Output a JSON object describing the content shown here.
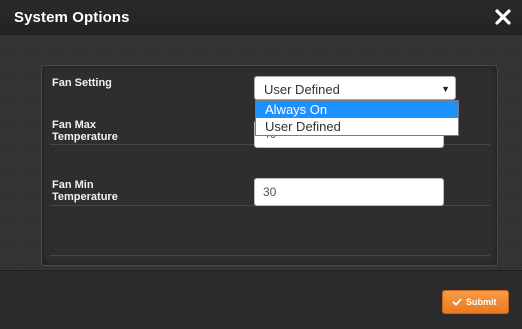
{
  "dialog": {
    "title": "System Options"
  },
  "fan_setting": {
    "label": "Fan Setting",
    "selected_value": "User Defined",
    "options": [
      "Always On",
      "User Defined"
    ],
    "highlighted_option": "Always On"
  },
  "fan_max_temperature": {
    "label_line1": "Fan Max",
    "label_line2": "Temperature",
    "value": "40"
  },
  "fan_min_temperature": {
    "label_line1": "Fan Min",
    "label_line2": "Temperature",
    "value": "30"
  },
  "footer": {
    "submit_label": "Submit"
  },
  "icons": {
    "close": "close-icon",
    "dropdown_arrow": "caret-down-icon",
    "submit": "check-icon"
  },
  "colors": {
    "accent": "#f08a2e",
    "highlight": "#1e90ff",
    "titlebar": "#262626"
  }
}
